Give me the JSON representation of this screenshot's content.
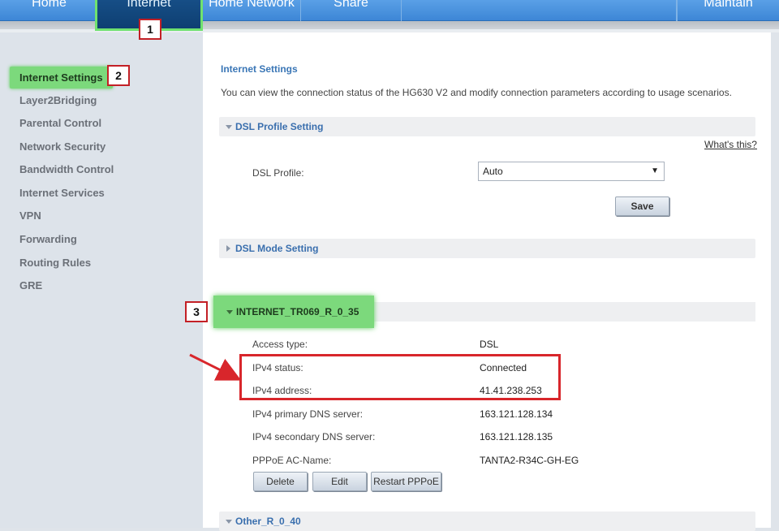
{
  "nav": {
    "tabs": [
      {
        "label": "Home"
      },
      {
        "label": "Internet"
      },
      {
        "label": "Home Network"
      },
      {
        "label": "Share"
      },
      {
        "label": "Maintain"
      }
    ],
    "active_tab": "Internet"
  },
  "sidebar": {
    "items": [
      {
        "label": "Internet Settings",
        "active": true
      },
      {
        "label": "Layer2Bridging"
      },
      {
        "label": "Parental Control"
      },
      {
        "label": "Network Security"
      },
      {
        "label": "Bandwidth Control"
      },
      {
        "label": "Internet Services"
      },
      {
        "label": "VPN"
      },
      {
        "label": "Forwarding"
      },
      {
        "label": "Routing Rules"
      },
      {
        "label": "GRE"
      }
    ]
  },
  "main": {
    "title": "Internet Settings",
    "description": "You can view the connection status of the HG630 V2 and modify connection parameters according to usage scenarios.",
    "dsl_profile_section": {
      "title": "DSL Profile Setting",
      "whats_this": "What's this?",
      "field_label": "DSL Profile:",
      "selected": "Auto",
      "save_label": "Save"
    },
    "dsl_mode_section": {
      "title": "DSL Mode Setting"
    },
    "connection": {
      "title": "INTERNET_TR069_R_0_35",
      "rows": [
        {
          "label": "Access type:",
          "value": "DSL"
        },
        {
          "label": "IPv4 status:",
          "value": "Connected"
        },
        {
          "label": "IPv4 address:",
          "value": "41.41.238.253"
        },
        {
          "label": "IPv4 primary DNS server:",
          "value": "163.121.128.134"
        },
        {
          "label": "IPv4 secondary DNS server:",
          "value": "163.121.128.135"
        },
        {
          "label": "PPPoE AC-Name:",
          "value": "TANTA2-R34C-GH-EG"
        }
      ],
      "buttons": {
        "delete": "Delete",
        "edit": "Edit",
        "restart": "Restart PPPoE"
      }
    },
    "other_section": {
      "title": "Other_R_0_40"
    }
  },
  "annotations": {
    "badge_1": "1",
    "badge_2": "2",
    "badge_3": "3",
    "highlight_color": "#7cd97c",
    "box_color": "#d8262b"
  }
}
